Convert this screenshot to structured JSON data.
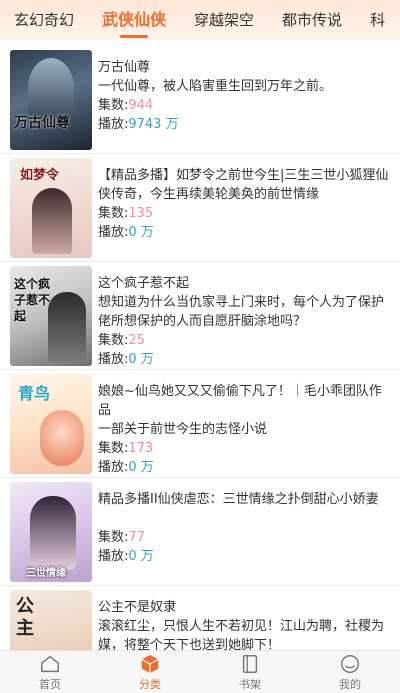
{
  "tabs": [
    "玄幻奇幻",
    "武侠仙侠",
    "穿越架空",
    "都市传说",
    "科"
  ],
  "active_tab_index": 1,
  "items": [
    {
      "title": "万古仙尊",
      "desc": "一代仙尊，被人陷害重生回到万年之前。",
      "episodes_label": "集数:",
      "episodes": "944",
      "plays_label": "播放:",
      "plays": "9743 万",
      "cover_text": "万古仙尊"
    },
    {
      "title": "【精品多播】如梦令之前世今生|三生三世小狐狸仙侠传奇，今生再续美轮美奂的前世情缘",
      "desc": "",
      "episodes_label": "集数:",
      "episodes": "135",
      "plays_label": "播放:",
      "plays": "0 万",
      "cover_text": "如梦令"
    },
    {
      "title": "这个疯子惹不起",
      "desc": "想知道为什么当仇家寻上门来时，每个人为了保护佬所想保护的人而自愿肝脑涂地吗？",
      "episodes_label": "集数:",
      "episodes": "25",
      "plays_label": "播放:",
      "plays": "0 万",
      "cover_text": "这个疯子惹不起"
    },
    {
      "title": "娘娘~仙鸟她又又又偷偷下凡了！｜毛小乖团队作品",
      "desc": "一部关于前世今生的志怪小说",
      "episodes_label": "集数:",
      "episodes": "173",
      "plays_label": "播放:",
      "plays": "0 万",
      "cover_text": "青鸟"
    },
    {
      "title": "精品多播II仙侠虐恋：三世情缘之扑倒甜心小娇妻",
      "desc": "",
      "episodes_label": "集数:",
      "episodes": "77",
      "plays_label": "播放:",
      "plays": "0 万",
      "cover_text": "三世情缘"
    },
    {
      "title": "公主不是奴隶",
      "desc": "滚滚红尘，只恨人生不若初见！江山为聘，社稷为媒，将整个天下也送到她脚下！",
      "episodes_label": "",
      "episodes": "",
      "plays_label": "",
      "plays": "",
      "cover_text": "公主"
    }
  ],
  "bottom_nav": [
    {
      "label": "首页",
      "icon": "home-icon"
    },
    {
      "label": "分类",
      "icon": "category-icon"
    },
    {
      "label": "书架",
      "icon": "bookshelf-icon"
    },
    {
      "label": "我的",
      "icon": "profile-icon"
    }
  ],
  "active_nav_index": 1,
  "colors": {
    "accent": "#f26b2a",
    "count_pink": "#f08bb0",
    "play_blue": "#2fa6c6"
  }
}
